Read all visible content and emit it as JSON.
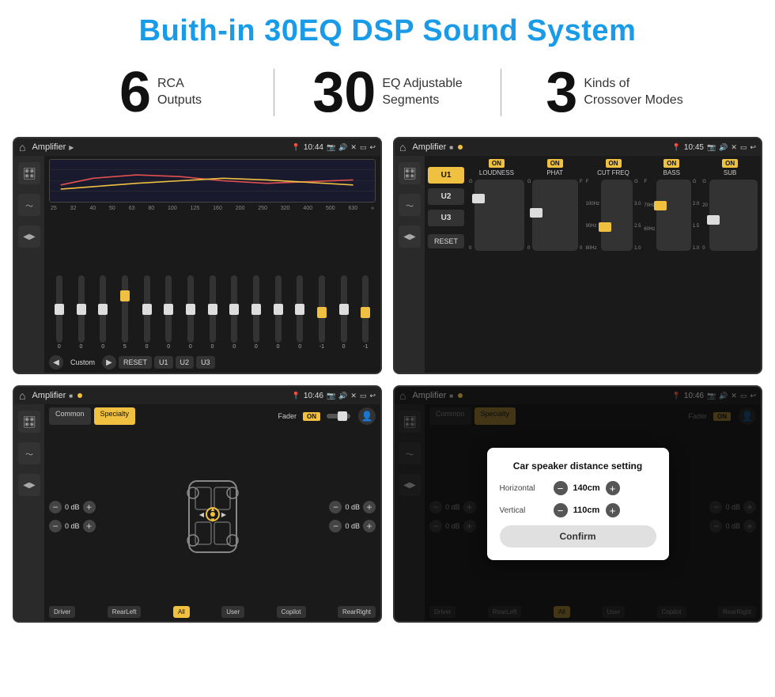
{
  "page": {
    "title": "Buith-in 30EQ DSP Sound System"
  },
  "stats": [
    {
      "number": "6",
      "label": "RCA\nOutputs"
    },
    {
      "number": "30",
      "label": "EQ Adjustable\nSegments"
    },
    {
      "number": "3",
      "label": "Kinds of\nCrossover Modes"
    }
  ],
  "screens": [
    {
      "id": "eq-screen",
      "status_bar": {
        "title": "Amplifier",
        "time": "10:44"
      },
      "type": "eq"
    },
    {
      "id": "crossover-screen",
      "status_bar": {
        "title": "Amplifier",
        "time": "10:45"
      },
      "type": "crossover"
    },
    {
      "id": "speaker-screen",
      "status_bar": {
        "title": "Amplifier",
        "time": "10:46"
      },
      "type": "speaker"
    },
    {
      "id": "dialog-screen",
      "status_bar": {
        "title": "Amplifier",
        "time": "10:46"
      },
      "type": "dialog"
    }
  ],
  "eq": {
    "frequencies": [
      "25",
      "32",
      "40",
      "50",
      "63",
      "80",
      "100",
      "125",
      "160",
      "200",
      "250",
      "320",
      "400",
      "500",
      "630"
    ],
    "values": [
      "0",
      "0",
      "0",
      "5",
      "0",
      "0",
      "0",
      "0",
      "0",
      "0",
      "0",
      "0",
      "-1",
      "0",
      "-1"
    ],
    "mode": "Custom",
    "buttons": [
      "RESET",
      "U1",
      "U2",
      "U3"
    ]
  },
  "crossover": {
    "u_buttons": [
      "U1",
      "U2",
      "U3"
    ],
    "columns": [
      {
        "on": true,
        "label": "LOUDNESS"
      },
      {
        "on": true,
        "label": "PHAT"
      },
      {
        "on": true,
        "label": "CUT FREQ"
      },
      {
        "on": true,
        "label": "BASS"
      },
      {
        "on": true,
        "label": "SUB"
      }
    ],
    "reset_label": "RESET"
  },
  "speaker": {
    "tabs": [
      "Common",
      "Specialty"
    ],
    "active_tab": "Specialty",
    "fader": {
      "label": "Fader",
      "on": true
    },
    "db_values": [
      "0 dB",
      "0 dB",
      "0 dB",
      "0 dB"
    ],
    "bottom_buttons": [
      "Driver",
      "",
      "RearLeft",
      "All",
      "",
      "User",
      "Copilot",
      "RearRight"
    ]
  },
  "dialog": {
    "title": "Car speaker distance setting",
    "horizontal_label": "Horizontal",
    "horizontal_value": "140cm",
    "vertical_label": "Vertical",
    "vertical_value": "110cm",
    "confirm_label": "Confirm",
    "db_values": [
      "0 dB",
      "0 dB"
    ],
    "bottom_buttons": [
      "Driver",
      "RearLeft",
      "",
      "User",
      "Copilot",
      "RearRight"
    ]
  }
}
